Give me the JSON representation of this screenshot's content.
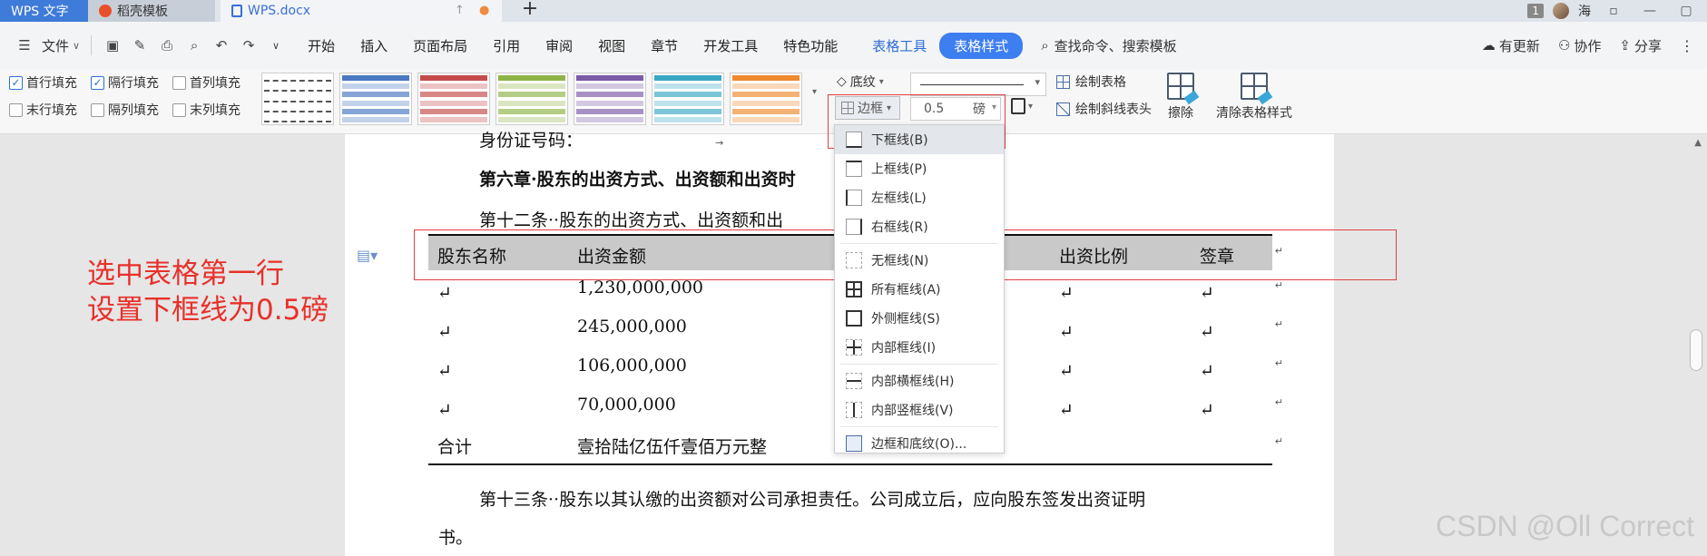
{
  "titlebar": {
    "tab_wps": "WPS 文字",
    "tab_docer": "稻壳模板",
    "tab_doc": "WPS.docx",
    "new_tab": "+",
    "page_badge": "1",
    "user": "海"
  },
  "menubar": {
    "file": "文件",
    "items": [
      "开始",
      "插入",
      "页面布局",
      "引用",
      "审阅",
      "视图",
      "章节",
      "开发工具",
      "特色功能"
    ],
    "tool_tab": "表格工具",
    "active_tab": "表格样式",
    "search": "查找命令、搜索模板",
    "update": "有更新",
    "collab": "协作",
    "share": "分享"
  },
  "ribbon": {
    "checkboxes": [
      {
        "label": "首行填充",
        "checked": true
      },
      {
        "label": "隔行填充",
        "checked": true
      },
      {
        "label": "首列填充",
        "checked": false
      },
      {
        "label": "末行填充",
        "checked": false
      },
      {
        "label": "隔列填充",
        "checked": false
      },
      {
        "label": "末列填充",
        "checked": false
      }
    ],
    "style_colors": [
      "#4a78c2",
      "#c54b4b",
      "#8fb446",
      "#7b5aa6",
      "#3aa7c3",
      "#ef8a2f"
    ],
    "shading": "底纹",
    "border": "边框",
    "line_width_value": "0.5",
    "line_width_unit": "磅",
    "draw_table": "绘制表格",
    "draw_diagonal": "绘制斜线表头",
    "erase": "擦除",
    "clear_style": "清除表格样式"
  },
  "document": {
    "line_top": "身份证号码：",
    "line_top_tail": "★",
    "chapter": "第六章·股东的出资方式、出资额和出资时",
    "article12": "第十二条··股东的出资方式、出资额和出",
    "table": {
      "headers": [
        "股东名称",
        "出资金额",
        "出资比例",
        "签章"
      ],
      "rows": [
        [
          "",
          "1,230,000,000",
          "",
          ""
        ],
        [
          "",
          "245,000,000",
          "",
          ""
        ],
        [
          "",
          "106,000,000",
          "",
          ""
        ],
        [
          "",
          "70,000,000",
          "",
          ""
        ],
        [
          "合计",
          "壹拾陆亿伍仟壹佰万元整",
          "",
          ""
        ]
      ]
    },
    "article13": "第十三条··股东以其认缴的出资额对公司承担责任。公司成立后，应向股东签发出资证明",
    "article13_cont": "书。"
  },
  "dropdown": {
    "items": [
      {
        "label": "下框线(B)",
        "icon": "border-bottom-icon"
      },
      {
        "label": "上框线(P)",
        "icon": "border-top-icon"
      },
      {
        "label": "左框线(L)",
        "icon": "border-left-icon"
      },
      {
        "label": "右框线(R)",
        "icon": "border-right-icon"
      },
      {
        "label": "无框线(N)",
        "icon": "border-none-icon"
      },
      {
        "label": "所有框线(A)",
        "icon": "border-all-icon"
      },
      {
        "label": "外侧框线(S)",
        "icon": "border-outside-icon"
      },
      {
        "label": "内部框线(I)",
        "icon": "border-inside-icon"
      },
      {
        "label": "内部横框线(H)",
        "icon": "border-inside-h-icon"
      },
      {
        "label": "内部竖框线(V)",
        "icon": "border-inside-v-icon"
      },
      {
        "label": "边框和底纹(O)...",
        "icon": "border-shading-icon"
      }
    ]
  },
  "annotation": {
    "line1": "选中表格第一行",
    "line2": "设置下框线为0.5磅"
  },
  "watermark": "CSDN @Oll Correct",
  "colors": {
    "accent": "#3d7ef0",
    "annotation_red": "#e8302a",
    "header_fill": "#c9c9c9"
  }
}
